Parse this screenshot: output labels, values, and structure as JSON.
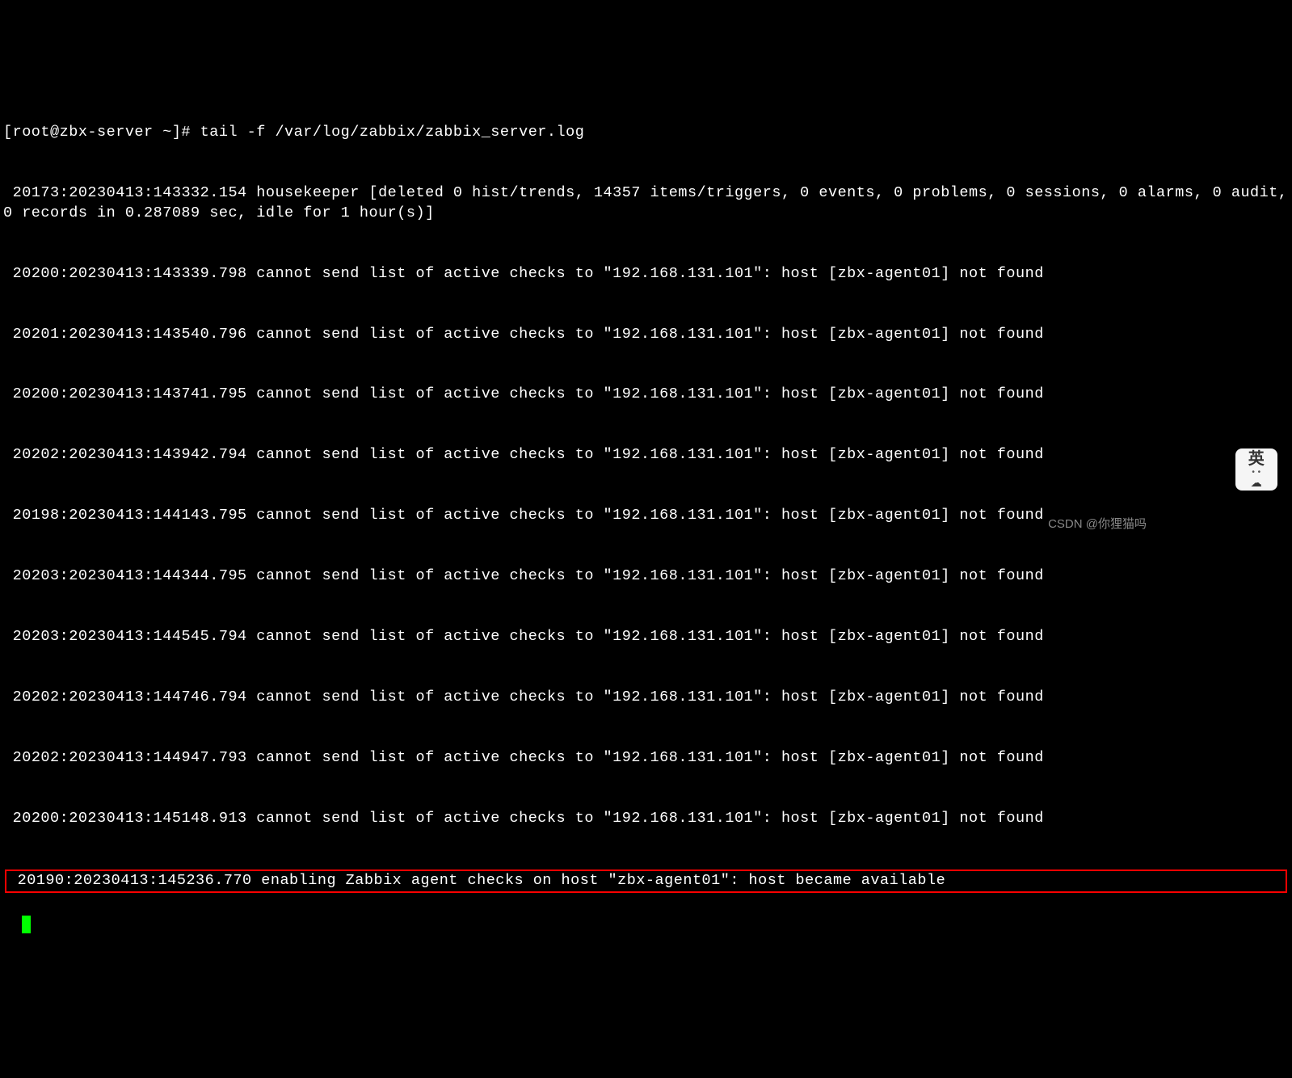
{
  "terminal": {
    "prompt_line": "[root@zbx-server ~]# tail -f /var/log/zabbix/zabbix_server.log",
    "lines": [
      " 20173:20230413:143332.154 housekeeper [deleted 0 hist/trends, 14357 items/triggers, 0 events, 0 problems, 0 sessions, 0 alarms, 0 audit, 0 records in 0.287089 sec, idle for 1 hour(s)]",
      " 20200:20230413:143339.798 cannot send list of active checks to \"192.168.131.101\": host [zbx-agent01] not found",
      " 20201:20230413:143540.796 cannot send list of active checks to \"192.168.131.101\": host [zbx-agent01] not found",
      " 20200:20230413:143741.795 cannot send list of active checks to \"192.168.131.101\": host [zbx-agent01] not found",
      " 20202:20230413:143942.794 cannot send list of active checks to \"192.168.131.101\": host [zbx-agent01] not found",
      " 20198:20230413:144143.795 cannot send list of active checks to \"192.168.131.101\": host [zbx-agent01] not found",
      " 20203:20230413:144344.795 cannot send list of active checks to \"192.168.131.101\": host [zbx-agent01] not found",
      " 20203:20230413:144545.794 cannot send list of active checks to \"192.168.131.101\": host [zbx-agent01] not found",
      " 20202:20230413:144746.794 cannot send list of active checks to \"192.168.131.101\": host [zbx-agent01] not found",
      " 20202:20230413:144947.793 cannot send list of active checks to \"192.168.131.101\": host [zbx-agent01] not found",
      " 20200:20230413:145148.913 cannot send list of active checks to \"192.168.131.101\": host [zbx-agent01] not found"
    ],
    "highlighted_line": " 20190:20230413:145236.770 enabling Zabbix agent checks on host \"zbx-agent01\": host became available"
  },
  "watermark": "CSDN @你狸猫吗",
  "ime": {
    "char": "英",
    "dots": "• •",
    "cloud": "☁"
  }
}
